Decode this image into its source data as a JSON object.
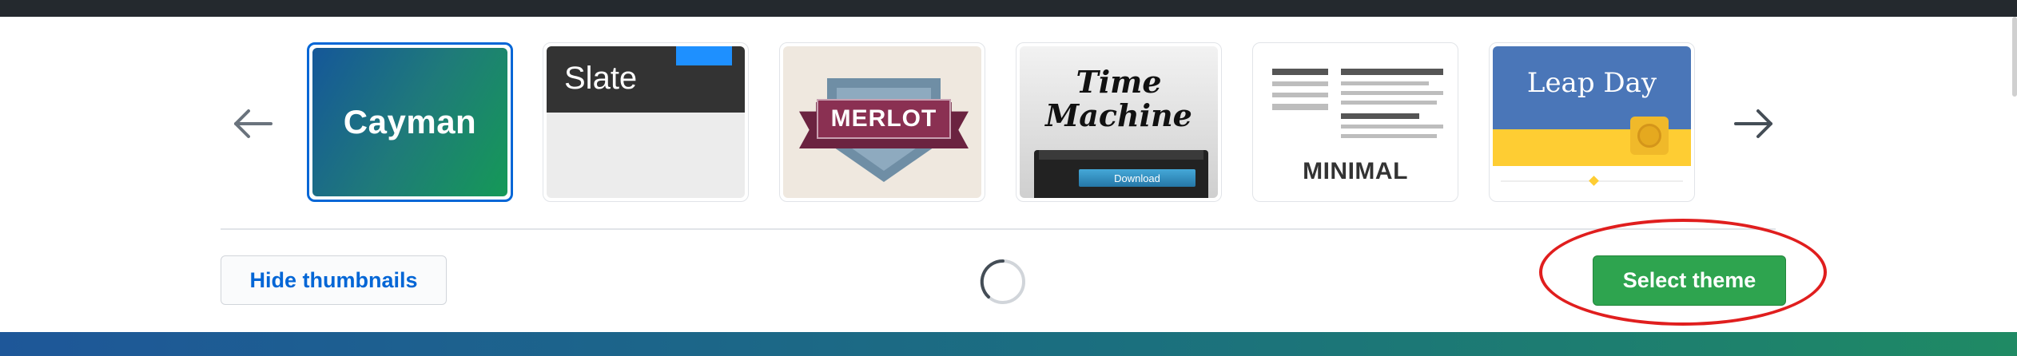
{
  "themes": [
    {
      "label": "Cayman",
      "selected": true
    },
    {
      "label": "Slate",
      "selected": false
    },
    {
      "label": "MERLOT",
      "selected": false
    },
    {
      "label": "Time Machine",
      "sub_button": "Download",
      "selected": false
    },
    {
      "label": "MINIMAL",
      "selected": false
    },
    {
      "label": "Leap Day",
      "selected": false
    }
  ],
  "controls": {
    "prev_icon": "arrow-left-icon",
    "next_icon": "arrow-right-icon",
    "hide_thumbnails_label": "Hide thumbnails",
    "select_theme_label": "Select theme",
    "loading_icon": "spinner-icon"
  },
  "colors": {
    "topbar": "#24292e",
    "selected_border": "#0366d6",
    "primary_button": "#2ea44f",
    "link": "#0366d6",
    "annotation": "#e01e1e"
  }
}
